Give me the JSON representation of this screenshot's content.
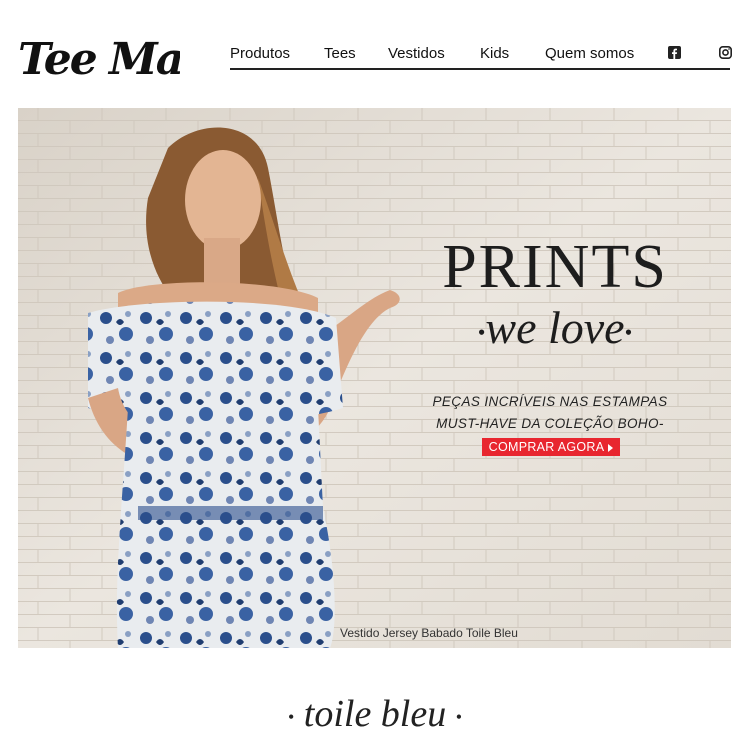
{
  "brand": {
    "logo_text": "Tee Match"
  },
  "nav": {
    "items": [
      "Produtos",
      "Tees",
      "Vestidos",
      "Kids",
      "Quem somos"
    ],
    "social": [
      "facebook-icon",
      "instagram-icon"
    ]
  },
  "hero": {
    "headline": "PRINTS",
    "subhead": "we love",
    "tagline_line1": "PEÇAS INCRÍVEIS NAS ESTAMPAS",
    "tagline_line2": "MUST-HAVE DA COLEÇÃO BOHO-CHINE",
    "cta_label": "COMPRAR AGORA",
    "caption": "Vestido Jersey Babado Toile Bleu"
  },
  "section": {
    "title": "toile bleu"
  },
  "colors": {
    "accent": "#e8262f",
    "text": "#1d1d1d",
    "dress_blue": "#2b4f8c"
  }
}
